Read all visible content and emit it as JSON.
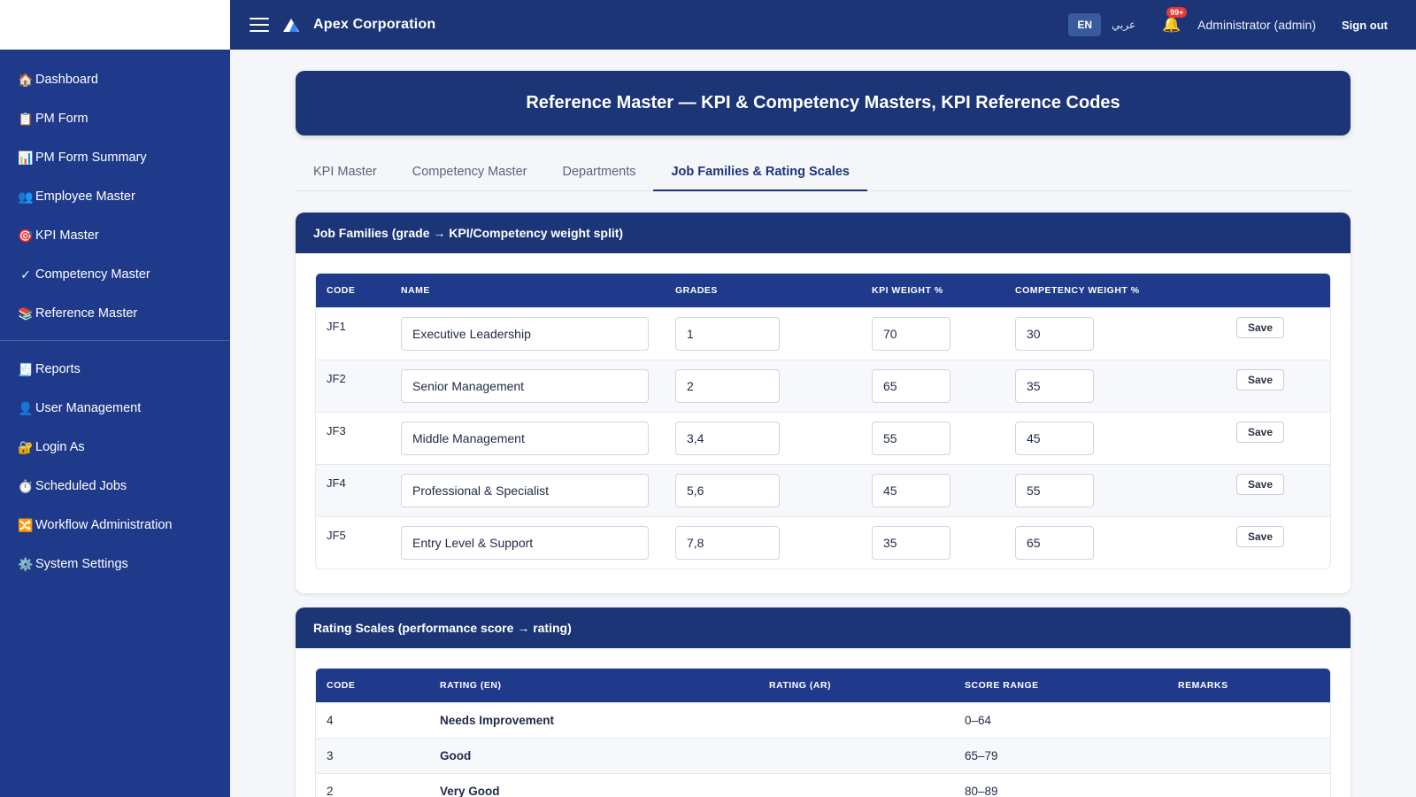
{
  "topbar": {
    "brand": "Apex Corporation",
    "lang_en": "EN",
    "lang_ar": "عربي",
    "notif_count": "99+",
    "user": "Administrator (admin)",
    "signout": "Sign out"
  },
  "sidebar": {
    "items": [
      {
        "icon": "🏠",
        "label": "Dashboard"
      },
      {
        "icon": "📋",
        "label": "PM Form"
      },
      {
        "icon": "📊",
        "label": "PM Form Summary"
      },
      {
        "icon": "👥",
        "label": "Employee Master"
      },
      {
        "icon": "🎯",
        "label": "KPI Master"
      },
      {
        "icon": "✓",
        "label": "Competency Master"
      },
      {
        "icon": "📚",
        "label": "Reference Master"
      },
      {
        "icon": "🧾",
        "label": "Reports"
      },
      {
        "icon": "👤",
        "label": "User Management"
      },
      {
        "icon": "🔐",
        "label": "Login As"
      },
      {
        "icon": "⏱️",
        "label": "Scheduled Jobs"
      },
      {
        "icon": "🔀",
        "label": "Workflow Administration"
      },
      {
        "icon": "⚙️",
        "label": "System Settings"
      }
    ]
  },
  "page": {
    "title": "Reference Master — KPI & Competency Masters, KPI Reference Codes"
  },
  "tabs": [
    {
      "label": "KPI Master",
      "active": false
    },
    {
      "label": "Competency Master",
      "active": false
    },
    {
      "label": "Departments",
      "active": false
    },
    {
      "label": "Job Families & Rating Scales",
      "active": true
    }
  ],
  "job_families": {
    "title": "Job Families (grade → KPI/Competency weight split)",
    "headers": {
      "code": "Code",
      "name": "Name",
      "grades": "Grades",
      "kpi": "KPI Weight %",
      "comp": "Competency Weight %"
    },
    "save_label": "Save",
    "rows": [
      {
        "code": "JF1",
        "name": "Executive Leadership",
        "grades": "1",
        "kpi": "70",
        "comp": "30"
      },
      {
        "code": "JF2",
        "name": "Senior Management",
        "grades": "2",
        "kpi": "65",
        "comp": "35"
      },
      {
        "code": "JF3",
        "name": "Middle Management",
        "grades": "3,4",
        "kpi": "55",
        "comp": "45"
      },
      {
        "code": "JF4",
        "name": "Professional & Specialist",
        "grades": "5,6",
        "kpi": "45",
        "comp": "55"
      },
      {
        "code": "JF5",
        "name": "Entry Level & Support",
        "grades": "7,8",
        "kpi": "35",
        "comp": "65"
      }
    ]
  },
  "rating_scales": {
    "title": "Rating Scales (performance score → rating)",
    "headers": {
      "code": "Code",
      "rating_en": "Rating (EN)",
      "rating_ar": "Rating (AR)",
      "range": "Score Range",
      "remarks": "Remarks"
    },
    "rows": [
      {
        "code": "4",
        "rating_en": "Needs Improvement",
        "rating_ar": "",
        "range": "0–64",
        "remarks": ""
      },
      {
        "code": "3",
        "rating_en": "Good",
        "rating_ar": "",
        "range": "65–79",
        "remarks": ""
      },
      {
        "code": "2",
        "rating_en": "Very Good",
        "rating_ar": "",
        "range": "80–89",
        "remarks": ""
      }
    ]
  }
}
